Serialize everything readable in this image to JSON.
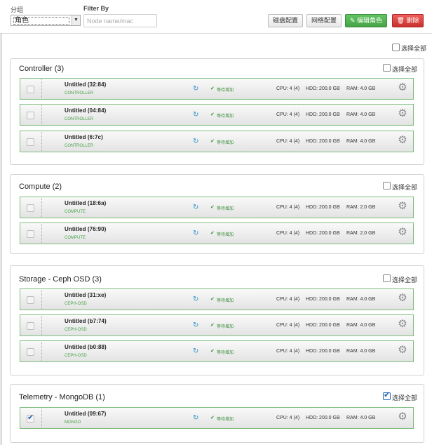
{
  "toolbar": {
    "group_label": "分组",
    "group_value": "角色",
    "filter_label": "Filter By",
    "filter_placeholder": "Node name/mac",
    "btn_disk": "磁盘配置",
    "btn_network": "网络配置",
    "btn_edit_roles": "✎ 编辑角色",
    "btn_delete": "🗑 删除"
  },
  "select_all_label": "选择全部",
  "groups": [
    {
      "title": "Controller",
      "count": "(3)",
      "checked": false,
      "nodes": [
        {
          "name": "Untitled (32:84)",
          "role": "CONTROLLER",
          "status": "等待增加",
          "cpu": "CPU: 4 (4)",
          "hdd": "HDD: 200.0 GB",
          "ram": "RAM: 4.0 GB",
          "checked": false
        },
        {
          "name": "Untitled (04:84)",
          "role": "CONTROLLER",
          "status": "等待增加",
          "cpu": "CPU: 4 (4)",
          "hdd": "HDD: 200.0 GB",
          "ram": "RAM: 4.0 GB",
          "checked": false
        },
        {
          "name": "Untitled (6:7c)",
          "role": "CONTROLLER",
          "status": "等待增加",
          "cpu": "CPU: 4 (4)",
          "hdd": "HDD: 200.0 GB",
          "ram": "RAM: 4.0 GB",
          "checked": false
        }
      ]
    },
    {
      "title": "Compute",
      "count": "(2)",
      "checked": false,
      "nodes": [
        {
          "name": "Untitled (18:6a)",
          "role": "COMPUTE",
          "status": "等待增加",
          "cpu": "CPU: 4 (4)",
          "hdd": "HDD: 200.0 GB",
          "ram": "RAM: 2.0 GB",
          "checked": false
        },
        {
          "name": "Untitled (76:90)",
          "role": "COMPUTE",
          "status": "等待增加",
          "cpu": "CPU: 4 (4)",
          "hdd": "HDD: 200.0 GB",
          "ram": "RAM: 2.0 GB",
          "checked": false
        }
      ]
    },
    {
      "title": "Storage - Ceph OSD",
      "count": "(3)",
      "checked": false,
      "nodes": [
        {
          "name": "Untitled (31:xe)",
          "role": "CEPH-OSD",
          "status": "等待增加",
          "cpu": "CPU: 4 (4)",
          "hdd": "HDD: 200.0 GB",
          "ram": "RAM: 4.0 GB",
          "checked": false
        },
        {
          "name": "Untitled (b7:74)",
          "role": "CEPH-OSD",
          "status": "等待增加",
          "cpu": "CPU: 4 (4)",
          "hdd": "HDD: 200.0 GB",
          "ram": "RAM: 4.0 GB",
          "checked": false
        },
        {
          "name": "Untitled (b0:88)",
          "role": "CEPH-OSD",
          "status": "等待增加",
          "cpu": "CPU: 4 (4)",
          "hdd": "HDD: 200.0 GB",
          "ram": "RAM: 4.0 GB",
          "checked": false
        }
      ]
    },
    {
      "title": "Telemetry - MongoDB",
      "count": "(1)",
      "checked": true,
      "nodes": [
        {
          "name": "Untitled (09:67)",
          "role": "MONGO",
          "status": "等待增加",
          "cpu": "CPU: 4 (4)",
          "hdd": "HDD: 200.0 GB",
          "ram": "RAM: 4.0 GB",
          "checked": true
        }
      ]
    }
  ],
  "icons": {
    "refresh": "refresh-icon",
    "status": "check-circle-icon",
    "gear": "gear-icon",
    "chevron": "chevron-down-icon"
  },
  "colors": {
    "node_border": "#7fbf7f",
    "role_text": "#4aa24a",
    "status_text": "#3a8e3a",
    "refresh": "#2e90c8",
    "success_button": "#47a447",
    "danger_button": "#c9302c"
  }
}
